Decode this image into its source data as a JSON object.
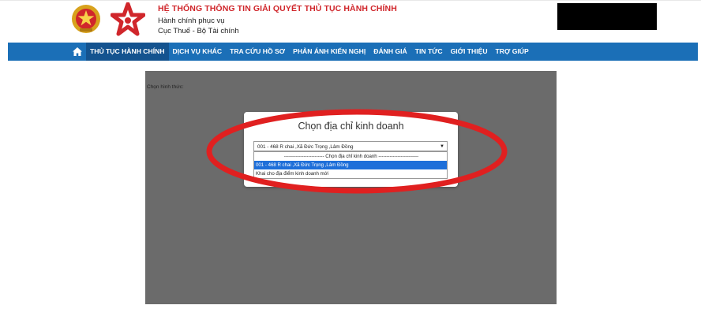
{
  "header": {
    "title": "HỆ THỐNG THÔNG TIN GIẢI QUYẾT THỦ TỤC HÀNH CHÍNH",
    "line2": "Hành chính phục vụ",
    "line3": "Cục Thuế - Bộ Tài chính"
  },
  "nav": {
    "items": [
      {
        "label": "THỦ TỤC HÀNH CHÍNH",
        "active": true
      },
      {
        "label": "DỊCH VỤ KHÁC"
      },
      {
        "label": "TRA CỨU HỒ SƠ"
      },
      {
        "label": "PHẢN ÁNH KIẾN NGHỊ"
      },
      {
        "label": "ĐÁNH GIÁ"
      },
      {
        "label": "TIN TỨC"
      },
      {
        "label": "GIỚI THIỆU"
      },
      {
        "label": "TRỢ GIÚP"
      }
    ]
  },
  "stage": {
    "label": "Chọn hình thức:"
  },
  "dialog": {
    "title": "Chọn địa chỉ kinh doanh",
    "select_value": "001 - 468 R chai ,Xã Đức Trọng ,Lâm Đồng",
    "options": [
      "------------------------- Chọn địa chỉ kinh doanh -------------------------",
      "001 - 468 R chai ,Xã Đức Trọng ,Lâm Đồng",
      "Khai cho địa điểm kinh doanh mới"
    ]
  },
  "colors": {
    "nav_bg": "#1b6fb7",
    "brand_red": "#d0262b",
    "highlight": "#1e6fd9",
    "annotation_red": "#e02020"
  }
}
